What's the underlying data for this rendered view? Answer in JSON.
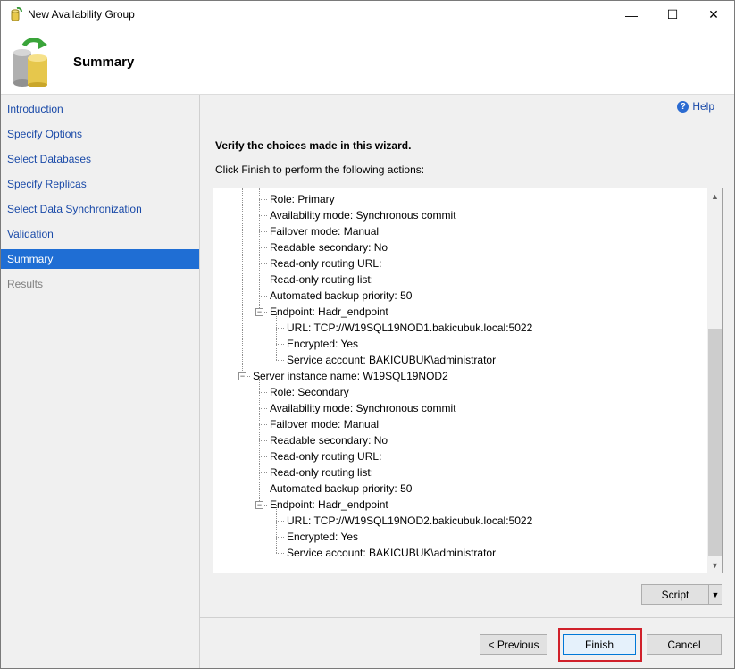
{
  "window": {
    "title": "New Availability Group",
    "minimize_glyph": "—",
    "maximize_glyph": "☐",
    "close_glyph": "✕"
  },
  "header": {
    "title": "Summary",
    "icon": "database-cylinder-icon"
  },
  "sidebar": {
    "items": [
      {
        "label": "Introduction",
        "state": "link"
      },
      {
        "label": "Specify Options",
        "state": "link"
      },
      {
        "label": "Select Databases",
        "state": "link"
      },
      {
        "label": "Specify Replicas",
        "state": "link"
      },
      {
        "label": "Select Data Synchronization",
        "state": "link"
      },
      {
        "label": "Validation",
        "state": "link"
      },
      {
        "label": "Summary",
        "state": "active"
      },
      {
        "label": "Results",
        "state": "disabled"
      }
    ]
  },
  "main": {
    "help_label": "Help",
    "verify_text": "Verify the choices made in this wizard.",
    "instruction_text": "Click Finish to perform the following actions:",
    "tree": [
      {
        "text": "Role: Primary",
        "level": 2
      },
      {
        "text": "Availability mode: Synchronous commit",
        "level": 2
      },
      {
        "text": "Failover mode: Manual",
        "level": 2
      },
      {
        "text": "Readable secondary: No",
        "level": 2
      },
      {
        "text": "Read-only routing URL:",
        "level": 2
      },
      {
        "text": "Read-only routing list:",
        "level": 2
      },
      {
        "text": "Automated backup priority: 50",
        "level": 2
      },
      {
        "text": "Endpoint: Hadr_endpoint",
        "level": 2,
        "expander": true
      },
      {
        "text": "URL: TCP://W19SQL19NOD1.bakicubuk.local:5022",
        "level": 3
      },
      {
        "text": "Encrypted: Yes",
        "level": 3
      },
      {
        "text": "Service account: BAKICUBUK\\administrator",
        "level": 3
      },
      {
        "text": "Server instance name: W19SQL19NOD2",
        "level": 1,
        "expander": true
      },
      {
        "text": "Role: Secondary",
        "level": 2
      },
      {
        "text": "Availability mode: Synchronous commit",
        "level": 2
      },
      {
        "text": "Failover mode: Manual",
        "level": 2
      },
      {
        "text": "Readable secondary: No",
        "level": 2
      },
      {
        "text": "Read-only routing URL:",
        "level": 2
      },
      {
        "text": "Read-only routing list:",
        "level": 2
      },
      {
        "text": "Automated backup priority: 50",
        "level": 2
      },
      {
        "text": "Endpoint: Hadr_endpoint",
        "level": 2,
        "expander": true
      },
      {
        "text": "URL: TCP://W19SQL19NOD2.bakicubuk.local:5022",
        "level": 3
      },
      {
        "text": "Encrypted: Yes",
        "level": 3
      },
      {
        "text": "Service account: BAKICUBUK\\administrator",
        "level": 3
      }
    ]
  },
  "buttons": {
    "script": "Script",
    "previous": "< Previous",
    "finish": "Finish",
    "cancel": "Cancel"
  },
  "colors": {
    "accent": "#1f6ed4",
    "link": "#1a4aa8",
    "highlight_border": "#d0202a"
  }
}
